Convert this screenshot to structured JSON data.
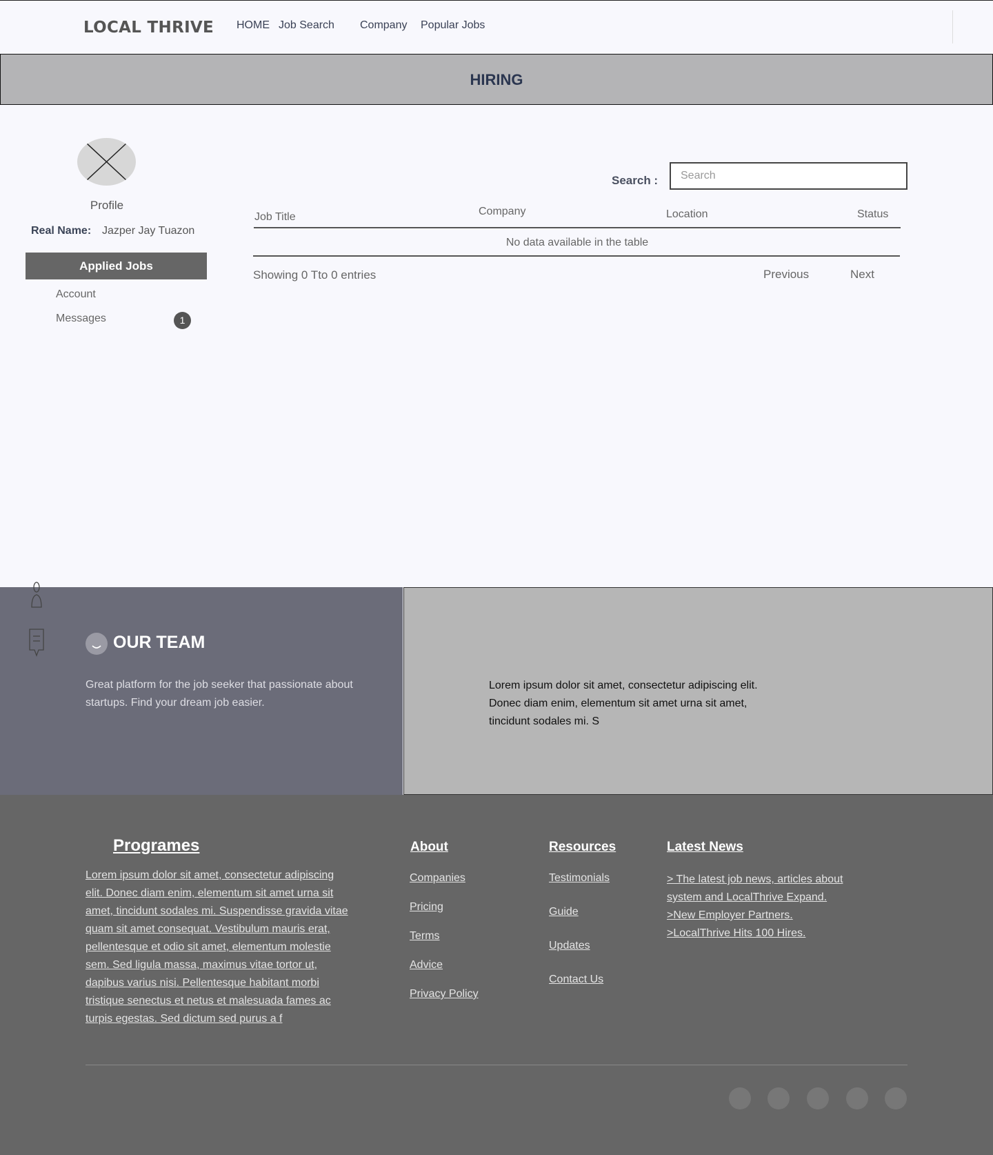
{
  "nav": {
    "brand": "LOCAL THRIVE",
    "links": [
      "HOME",
      "Job Search",
      "Company",
      "Popular Jobs"
    ]
  },
  "hero": {
    "title": "HIRING"
  },
  "sidebar": {
    "profile_label": "Profile",
    "real_name_label": "Real Name:",
    "real_name_value": "Jazper Jay Tuazon",
    "applied_jobs_label": "Applied Jobs",
    "account_label": "Account",
    "messages_label": "Messages",
    "messages_count": "1"
  },
  "search": {
    "label": "Search :",
    "placeholder": "Search",
    "value": ""
  },
  "table": {
    "columns": [
      "Job Title",
      "Company",
      "Location",
      "Status"
    ],
    "empty_message": "No data available in the table",
    "showing": "Showing 0 Tto 0 entries",
    "previous_label": "Previous",
    "next_label": "Next"
  },
  "team": {
    "title": "OUR TEAM",
    "description": "Great platform for the job seeker that passionate about startups. Find your dream job easier.",
    "lorem": "Lorem ipsum dolor sit amet, consectetur adipiscing elit. Donec diam enim, elementum sit amet urna sit amet, tincidunt sodales mi. S"
  },
  "footer": {
    "programes_title": "Programes",
    "programes_text": "Lorem ipsum dolor sit amet, consectetur adipiscing elit. Donec diam enim, elementum sit amet urna sit amet, tincidunt sodales mi. Suspendisse gravida vitae quam sit amet consequat. Vestibulum mauris erat, pellentesque et odio sit amet, elementum molestie sem. Sed ligula massa, maximus vitae tortor ut, dapibus varius nisi. Pellentesque habitant morbi tristique senectus et netus et malesuada fames ac turpis egestas. Sed dictum sed purus a f",
    "about_title": "About",
    "about_links": [
      "Companies",
      "Pricing",
      "Terms",
      "Advice",
      "Privacy Policy"
    ],
    "resources_title": "Resources",
    "resources_links": [
      "Testimonials",
      "Guide",
      "Updates",
      "Contact Us"
    ],
    "news_title": "Latest News",
    "news_items": [
      "> The latest job news, articles about system and LocalThrive Expand.",
      ">New Employer Partners.",
      ">LocalThrive Hits 100 Hires."
    ]
  },
  "colors": {
    "hiring_bar": "#b4b4b6",
    "team_left": "#6b6c79",
    "team_right": "#b6b6b6",
    "footer": "#666666",
    "applied_button": "#666666"
  },
  "icons": [
    "avatar-placeholder-icon",
    "location-pin-icon",
    "chat-icon",
    "team-icon",
    "social-icon"
  ]
}
